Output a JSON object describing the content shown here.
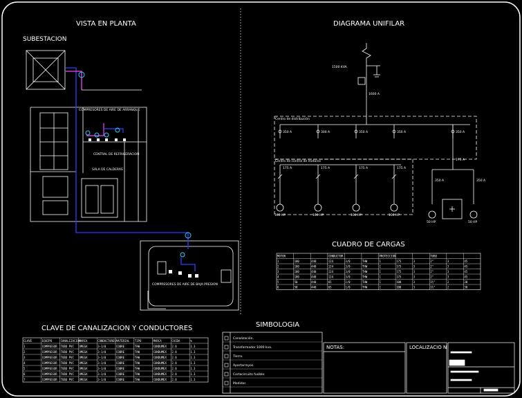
{
  "titles": {
    "plan": "VISTA EN PLANTA",
    "substation": "SUBESTACION",
    "single_line": "DIAGRAMA UNIFILAR",
    "load_table": "CUADRO DE CARGAS",
    "conduit_key": "CLAVE DE CANALIZACION Y CONDUCTORES",
    "symbols": "SIMBOLOGIA",
    "notes": "NOTAS:",
    "location": "LOCALIZACIO N"
  },
  "plan_labels": {
    "compressors_top": "COMPRESORES DE AIRE DE ARRANQUE",
    "refrigeration": "CENTRAL DE REFRIGERACION",
    "boiler_room": "SALA DE CALDERAS",
    "compressors_low": "COMPRESORES DE AIRE DE BAJA PRESION"
  },
  "single_line": {
    "transformer": "1500 KVA",
    "main_breaker": "1600 A",
    "dist_center": "Centro de distribución",
    "motor_center": "Centro de control de motores",
    "dist_breakers": [
      "350 A",
      "300 A",
      "350 A",
      "350 A",
      "350 A"
    ],
    "motor_breakers": [
      "175 A",
      "175 A",
      "175 A",
      "175 A"
    ],
    "right_breaker": "175 A",
    "right_sub": [
      "350 A",
      "350 A"
    ],
    "motor_ratings": [
      "100 HP",
      "100 HP",
      "100 HP",
      "100 HP",
      "50 HP",
      "50 HP"
    ]
  },
  "load_table": {
    "headers": [
      "MOTOR",
      "",
      "",
      "CONDUCTOR",
      "",
      "",
      "PROTECCION",
      "",
      "",
      "TUBO",
      "",
      ""
    ],
    "rows": [
      [
        "1",
        "100",
        "440",
        "124",
        "3/0",
        "THW",
        "1",
        "175",
        "3",
        "2\"",
        "3",
        "45"
      ],
      [
        "2",
        "100",
        "440",
        "124",
        "3/0",
        "THW",
        "1",
        "175",
        "3",
        "2\"",
        "3",
        "45"
      ],
      [
        "3",
        "100",
        "440",
        "124",
        "3/0",
        "THW",
        "1",
        "175",
        "3",
        "2\"",
        "3",
        "45"
      ],
      [
        "4",
        "100",
        "440",
        "124",
        "3/0",
        "THW",
        "1",
        "175",
        "3",
        "2\"",
        "3",
        "45"
      ],
      [
        "5",
        "50",
        "440",
        "65",
        "1/0",
        "THW",
        "1",
        "100",
        "3",
        "1½\"",
        "2",
        "30"
      ],
      [
        "6",
        "50",
        "440",
        "65",
        "1/0",
        "THW",
        "1",
        "100",
        "3",
        "1½\"",
        "2",
        "30"
      ]
    ]
  },
  "conduit_key": {
    "headers": [
      "CLAVE",
      "EQUIPO",
      "CANALIZACION",
      "MARCA",
      "CONDUCTORES",
      "MATERIAL",
      "TIPO",
      "MARCA",
      "CAIDA",
      "%"
    ],
    "rows": [
      [
        "1",
        "COMPRESOR",
        "TUBO PVC",
        "OMEGA",
        "3-1/0",
        "COBRE",
        "THW",
        "CONDUMEX",
        "2.8",
        "1.3"
      ],
      [
        "2",
        "COMPRESOR",
        "TUBO PVC",
        "OMEGA",
        "3-1/0",
        "COBRE",
        "THW",
        "CONDUMEX",
        "2.8",
        "1.3"
      ],
      [
        "3",
        "COMPRESOR",
        "TUBO PVC",
        "OMEGA",
        "3-1/0",
        "COBRE",
        "THW",
        "CONDUMEX",
        "2.8",
        "1.3"
      ],
      [
        "4",
        "COMPRESOR",
        "TUBO PVC",
        "OMEGA",
        "3-1/0",
        "COBRE",
        "THW",
        "CONDUMEX",
        "2.8",
        "1.3"
      ],
      [
        "5",
        "COMPRESOR",
        "TUBO PVC",
        "OMEGA",
        "3-1/0",
        "COBRE",
        "THW",
        "CONDUMEX",
        "2.8",
        "1.3"
      ],
      [
        "6",
        "COMPRESOR",
        "TUBO PVC",
        "OMEGA",
        "3-1/0",
        "COBRE",
        "THW",
        "CONDUMEX",
        "2.8",
        "1.3"
      ],
      [
        "7",
        "COMPRESOR",
        "TUBO PVC",
        "OMEGA",
        "3-1/0",
        "COBRE",
        "THW",
        "CONDUMEX",
        "2.8",
        "1.3"
      ]
    ]
  },
  "symbols": [
    "Canalización.",
    "Transformador 1000 kva.",
    "Tierra.",
    "Apartarrayos.",
    "Cortacircuito fusible.",
    "Medidor."
  ]
}
